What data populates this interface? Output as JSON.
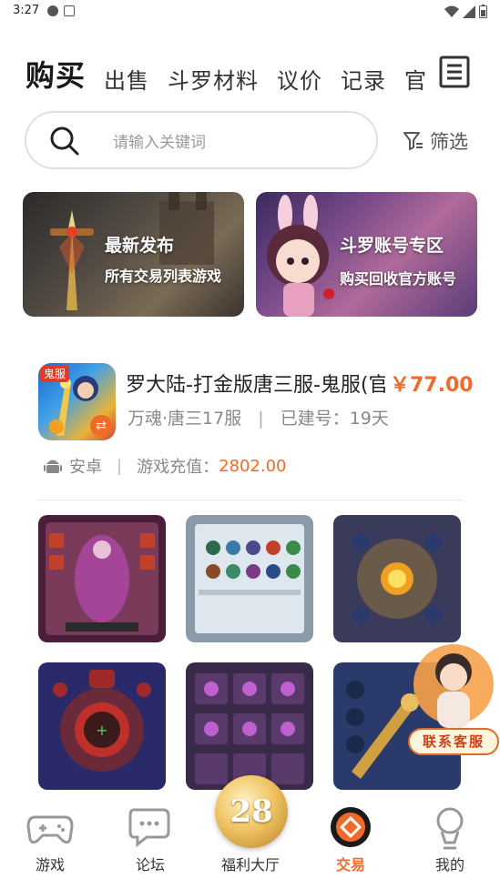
{
  "status_bar": {
    "time": "3:27"
  },
  "top_tabs": [
    {
      "label": "购买",
      "active": true
    },
    {
      "label": "出售",
      "active": false
    },
    {
      "label": "斗罗材料",
      "active": false
    },
    {
      "label": "议价",
      "active": false
    },
    {
      "label": "记录",
      "active": false
    },
    {
      "label": "官",
      "active": false
    }
  ],
  "search": {
    "placeholder": "请输入关键词",
    "filter_label": "筛选"
  },
  "banners": [
    {
      "title": "最新发布",
      "subtitle": "所有交易列表游戏"
    },
    {
      "title": "斗罗账号专区",
      "subtitle": "购买回收官方账号"
    }
  ],
  "listing": {
    "icon_tag": "鬼服",
    "title": "罗大陆-打金版唐三服-鬼服(官",
    "price": "￥77.00",
    "server": "万魂·唐三17服",
    "meta_sep": "|",
    "days_label": "已建号：19天",
    "platform": "安卓",
    "recharge_label": "游戏充值：",
    "recharge_value": "2802.00"
  },
  "support": {
    "label": "联系客服"
  },
  "bottom_nav": [
    {
      "label": "游戏",
      "icon": "gamepad-icon",
      "active": false
    },
    {
      "label": "论坛",
      "icon": "chat-bubbles-icon",
      "active": false
    },
    {
      "label": "福利大厅",
      "icon": "welfare-badge-icon",
      "active": false
    },
    {
      "label": "交易",
      "icon": "trade-icon",
      "active": true
    },
    {
      "label": "我的",
      "icon": "profile-icon",
      "active": false
    }
  ],
  "welfare_badge": "28",
  "colors": {
    "accent": "#f26a2a",
    "text": "#333333",
    "muted": "#888888"
  }
}
